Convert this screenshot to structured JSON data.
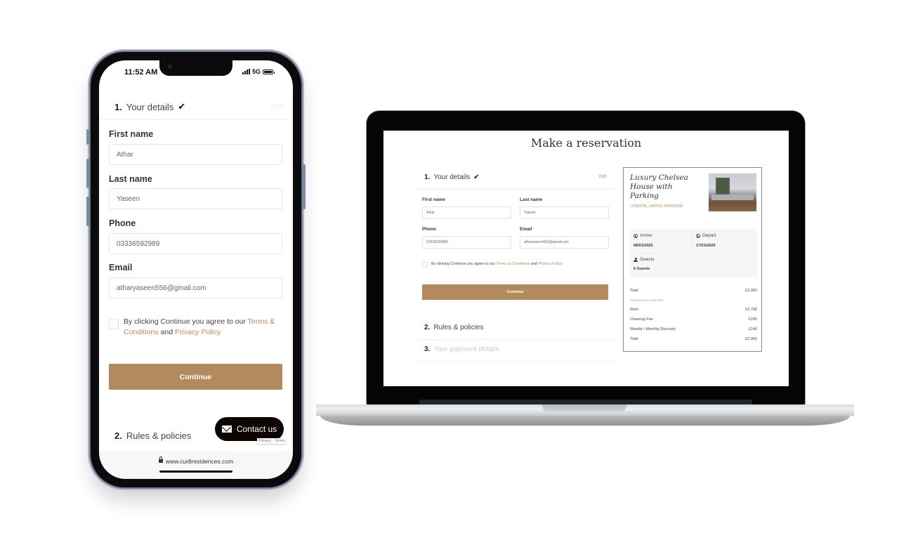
{
  "phone": {
    "status": {
      "time": "11:52 AM",
      "network": "5G"
    },
    "steps": [
      {
        "num": "1.",
        "label": "Your details",
        "edit": "Edit"
      },
      {
        "num": "2.",
        "label": "Rules & policies"
      }
    ],
    "form": {
      "first_name": {
        "label": "First name",
        "value": "Athar"
      },
      "last_name": {
        "label": "Last name",
        "value": "Yaseen"
      },
      "phone": {
        "label": "Phone",
        "value": "03336592989"
      },
      "email": {
        "label": "Email",
        "value": "atharyaseen556@gmail.com"
      }
    },
    "terms": {
      "prefix": "By clicking Continue you agree to our ",
      "terms_link": "Terms & Conditions",
      "and": " and ",
      "privacy_link": "Privacy Policy"
    },
    "continue_label": "Continue",
    "contact_label": "Contact us",
    "recaptcha": "Privacy - Terms",
    "url": "www.cur8residences.com"
  },
  "laptop": {
    "title": "Make a reservation",
    "steps": [
      {
        "num": "1.",
        "label": "Your details",
        "edit": "Edit"
      },
      {
        "num": "2.",
        "label": "Rules & policies"
      },
      {
        "num": "3.",
        "label": "Your payment details"
      }
    ],
    "form": {
      "first_name": {
        "label": "First name",
        "value": "Athar"
      },
      "last_name": {
        "label": "Last name",
        "value": "Yaseen"
      },
      "phone": {
        "label": "Phone",
        "value": "03336592989"
      },
      "email": {
        "label": "Email",
        "value": "atharyaseen556@gmail.com"
      }
    },
    "terms": {
      "prefix": "By clicking Continue you agree to our ",
      "terms_link": "Terms & Conditions",
      "and": " and ",
      "privacy_link": "Privacy Policy"
    },
    "continue_label": "Continue",
    "summary": {
      "property_name": "Luxury Chelsea House with Parking",
      "location": "LONDON, UNITED KINGDOM",
      "arrive_label": "Arrive",
      "arrive_date": "08/01/2025",
      "depart_label": "Depart",
      "depart_date": "17/01/2025",
      "guests_label": "Guests",
      "guests_value": "6 Guests",
      "total_label": "Total",
      "total_value": "£2,981",
      "note": "Includes taxes and fees",
      "lines": [
        {
          "label": "Rent",
          "value": "£2,706"
        },
        {
          "label": "Cleaning Fee",
          "value": "£200"
        },
        {
          "label": "Weekly / Monthly Discount",
          "value": "£146"
        },
        {
          "label": "Total",
          "value": "£2,981"
        }
      ]
    }
  },
  "colors": {
    "accent": "#b38a5e",
    "dark": "#0d0404"
  }
}
